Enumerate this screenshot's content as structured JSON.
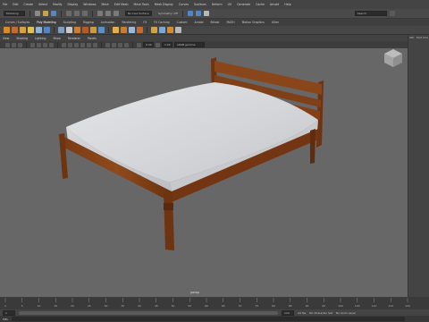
{
  "menubar": {
    "items": [
      "File",
      "Edit",
      "Create",
      "Select",
      "Modify",
      "Display",
      "Windows",
      "Mesh",
      "Edit Mesh",
      "Mesh Tools",
      "Mesh Display",
      "Curves",
      "Surfaces",
      "Deform",
      "UV",
      "Generate",
      "Cache",
      "Arnold",
      "Help"
    ]
  },
  "statusline": {
    "workspace_select": "Modeling",
    "menu_select": "No Live Surface",
    "symmetry": "Symmetry: Off",
    "search_placeholder": "Search"
  },
  "shelf": {
    "tabs": [
      "Curves / Surfaces",
      "Poly Modeling",
      "Sculpting",
      "Rigging",
      "Animation",
      "Rendering",
      "FX",
      "FX Caching",
      "Custom",
      "Arnold",
      "Bifrost",
      "MASH",
      "Motion Graphics",
      "XGen"
    ],
    "active_tab": "Poly Modeling",
    "icon_colors": [
      "#d98b2b",
      "#c96a2a",
      "#d4a243",
      "#e2c04a",
      "#8fb2d6",
      "#4f86c7",
      "#7aa1c9",
      "#c9c9c9",
      "#d17d2f",
      "#b55b2a",
      "#cf9a3a",
      "#5d8fc2",
      "#e0b14a",
      "#d07a2e",
      "#9bb9db",
      "#c96a2a",
      "#d4a243",
      "#7fa6cf",
      "#d98b2b",
      "#b8b8b8"
    ]
  },
  "panel_menu": {
    "items": [
      "View",
      "Shading",
      "Lighting",
      "Show",
      "Renderer",
      "Panels"
    ]
  },
  "viewport_toolbar": {
    "field_value": "0.00",
    "field2_value": "1.00",
    "colorspace": "sRGB gamma"
  },
  "viewport": {
    "camera_label": "persp",
    "background": "#676767"
  },
  "right_panel": {
    "tabs": [
      "Attr",
      "Mod",
      "Cha"
    ]
  },
  "timeslider": {
    "ticks": [
      "1",
      "5",
      "10",
      "15",
      "20",
      "25",
      "30",
      "35",
      "40",
      "45",
      "50",
      "55",
      "60",
      "65",
      "70",
      "75",
      "80",
      "85",
      "90",
      "95",
      "100",
      "105",
      "110",
      "115",
      "120"
    ]
  },
  "rangebar": {
    "start": "1",
    "end": "120",
    "char_set": "No Character Set",
    "anim_layer": "No Anim Layer",
    "fps": "24 fps"
  },
  "cmdline": {
    "label": "MEL"
  }
}
